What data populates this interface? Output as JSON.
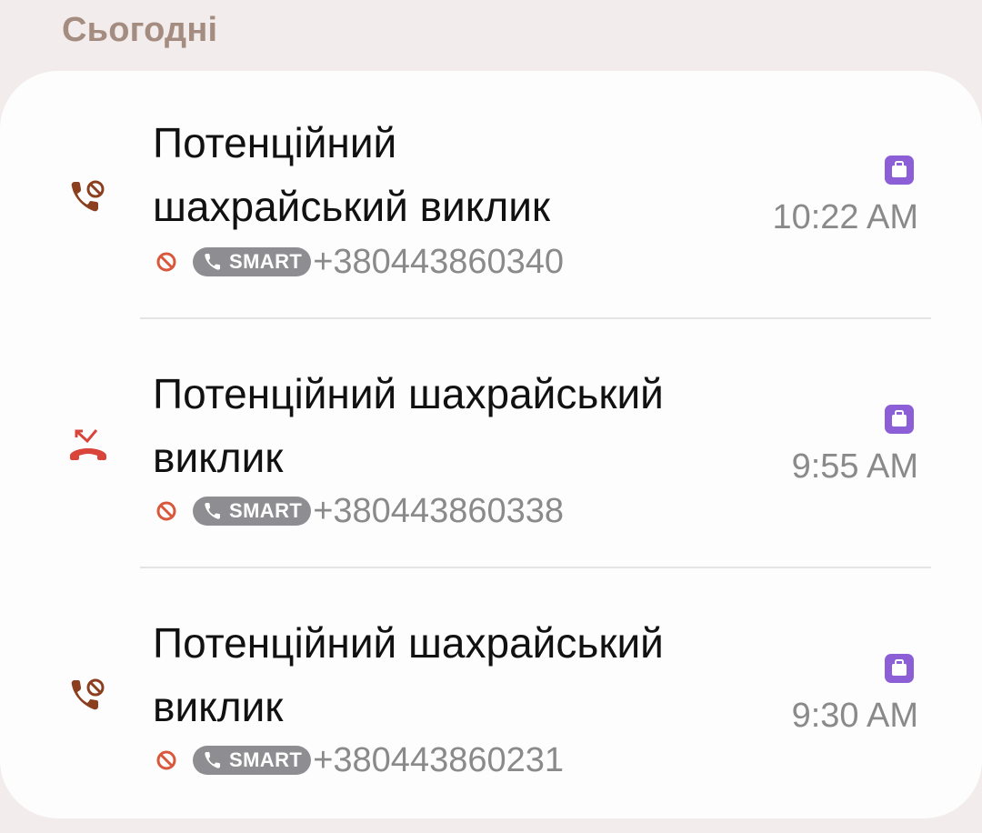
{
  "section": {
    "label": "Сьогодні"
  },
  "calls": [
    {
      "icon": "blocked-call-icon",
      "title": "Потенційний шахрайський виклик",
      "title_line1": "Потенційний",
      "title_line2": "шахрайський виклик",
      "badge": "SMART",
      "number": "+380443860340",
      "time": "10:22 AM"
    },
    {
      "icon": "rejected-call-icon",
      "title": "Потенційний шахрайський виклик",
      "title_line1": "Потенційний шахрайський",
      "title_line2": "виклик",
      "badge": "SMART",
      "number": "+380443860338",
      "time": "9:55 AM"
    },
    {
      "icon": "blocked-call-icon",
      "title": "Потенційний шахрайський виклик",
      "title_line1": "Потенційний шахрайський",
      "title_line2": "виклик",
      "badge": "SMART",
      "number": "+380443860231",
      "time": "9:30 AM"
    }
  ],
  "colors": {
    "header": "#a48c80",
    "blocked_icon": "#8b3f1e",
    "rejected_icon": "#d9453b",
    "work_badge": "#8c5fd6",
    "smart_pill": "#8e8e92"
  }
}
